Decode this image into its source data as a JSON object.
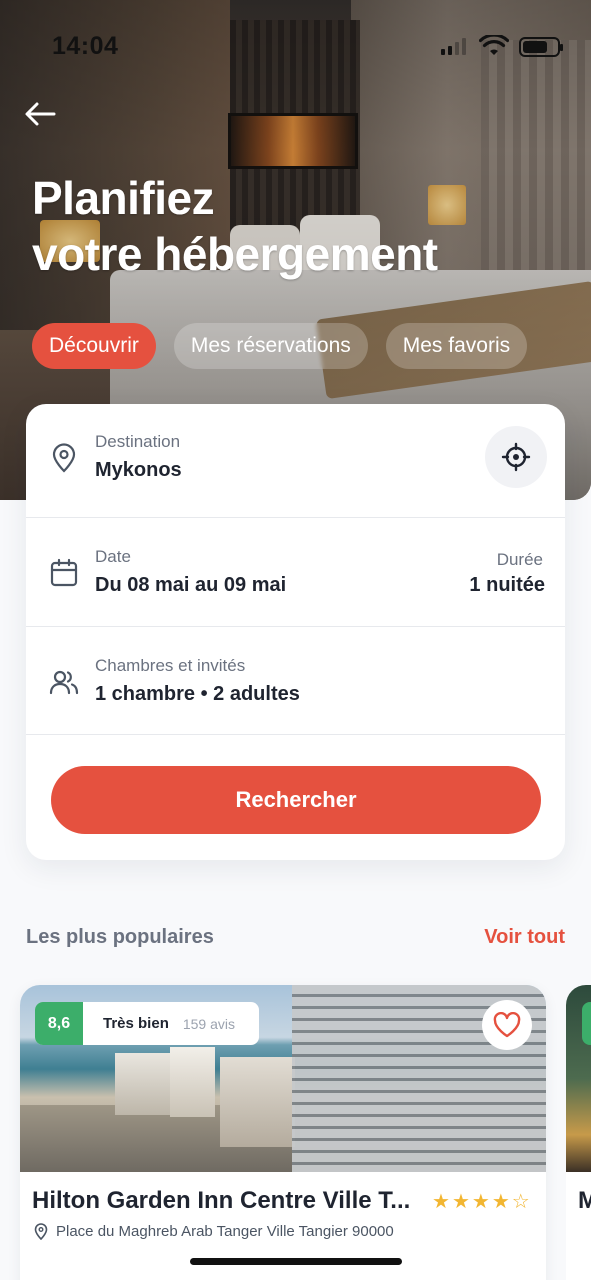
{
  "status_bar": {
    "time": "14:04"
  },
  "hero": {
    "title_line1": "Planifiez",
    "title_line2": "votre hébergement",
    "tabs": [
      {
        "label": "Découvrir",
        "active": true
      },
      {
        "label": "Mes réservations",
        "active": false
      },
      {
        "label": "Mes favoris",
        "active": false
      }
    ]
  },
  "search_form": {
    "destination": {
      "label": "Destination",
      "value": "Mykonos",
      "icon": "map-pin-icon"
    },
    "date": {
      "label": "Date",
      "value": "Du 08 mai au 09 mai",
      "icon": "calendar-icon"
    },
    "duration": {
      "label": "Durée",
      "value": "1 nuitée"
    },
    "guests": {
      "label": "Chambres et invités",
      "value": "1 chambre • 2 adultes",
      "icon": "users-icon"
    },
    "search_button": "Rechercher"
  },
  "popular": {
    "title": "Les plus populaires",
    "see_all": "Voir tout",
    "hotels": [
      {
        "score": "8,6",
        "score_word": "Très bien",
        "reviews": "159 avis",
        "name": "Hilton Garden Inn Centre Ville T...",
        "stars": 4,
        "address": "Place du Maghreb Arab Tanger Ville Tangier 90000"
      }
    ],
    "next_hotel_initial": "M"
  },
  "colors": {
    "accent": "#e5513f",
    "score_green": "#3cae6a",
    "star": "#f2b632"
  }
}
